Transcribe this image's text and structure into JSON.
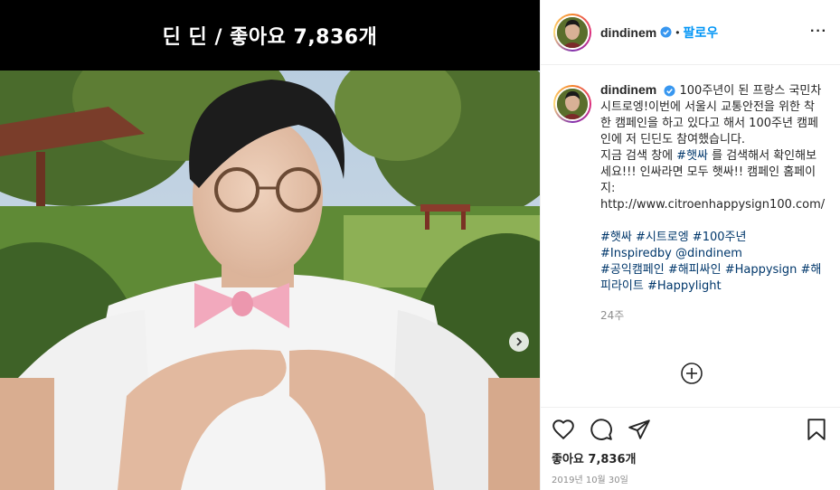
{
  "photo": {
    "overlay_title": "딘 딘 / 좋아요 7,836개"
  },
  "header": {
    "username": "dindinem",
    "separator": "•",
    "follow_label": "팔로우",
    "more_label": "···"
  },
  "caption": {
    "username": "dindinem",
    "lines": [
      "100주년이 된 프랑스 국민차 시트로엥!이번에 서울시 교통안전을 위한 착한 캠페인을 하고 있다고 해서 100주년 캠페인에 저 딘딘도 참여했습니다.",
      "지금 검색 창에 ",
      "#햇싸",
      " 를 검색해서 확인해보세요!!! 인싸라면 모두 햇싸!! 캠페인 홈페이지: http://www.citroenhappysign100.com/"
    ],
    "hashtags_line1": "#햇싸 #시트로엥 #100주년",
    "hashtags_line2": "#Inspiredby @dindinem",
    "hashtags_line3": "#공익캠페인 #해피싸인 #Happysign #해피라이트 #Happylight",
    "time": "24주"
  },
  "actions": {
    "likes": "좋아요 7,836개",
    "date": "2019년 10월 30일"
  },
  "colors": {
    "follow": "#0095f6",
    "hashtag": "#00376b",
    "verified": "#3897f0",
    "muted": "#8e8e8e"
  },
  "icons": [
    "verified-icon",
    "more-icon",
    "heart-icon",
    "comment-icon",
    "share-icon",
    "bookmark-icon",
    "add-comment-icon",
    "next-arrow-icon"
  ]
}
